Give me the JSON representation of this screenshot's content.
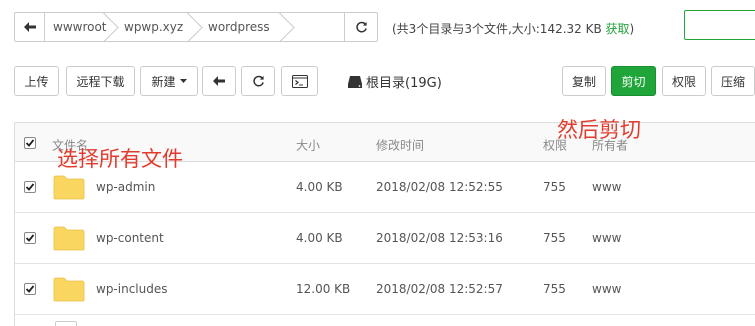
{
  "path": {
    "crumbs": [
      "wwwroot",
      "wpwp.xyz",
      "wordpress"
    ],
    "summary_text": "(共3个目录与3个文件,大小:142.32 KB ",
    "fetch_label": "获取",
    "summary_close": ")"
  },
  "toolbar": {
    "upload": "上传",
    "remote_download": "远程下载",
    "new": "新建",
    "disk_label": "根目录(19G)",
    "copy": "复制",
    "cut": "剪切",
    "permission": "权限",
    "compress": "压缩"
  },
  "table": {
    "headers": {
      "name": "文件名",
      "size": "大小",
      "modified": "修改时间",
      "perm": "权限",
      "owner": "所有者"
    },
    "rows": [
      {
        "name": "wp-admin",
        "size": "4.00 KB",
        "modified": "2018/02/08 12:52:55",
        "perm": "755",
        "owner": "www",
        "checked": true
      },
      {
        "name": "wp-content",
        "size": "4.00 KB",
        "modified": "2018/02/08 12:53:16",
        "perm": "755",
        "owner": "www",
        "checked": true
      },
      {
        "name": "wp-includes",
        "size": "12.00 KB",
        "modified": "2018/02/08 12:52:57",
        "perm": "755",
        "owner": "www",
        "checked": true
      }
    ]
  },
  "annotations": {
    "select_all": "选择所有文件",
    "then_cut": "然后剪切"
  },
  "colors": {
    "accent": "#20a53a",
    "annotation": "#e23b2e",
    "folder": "#f9d65f"
  },
  "icons": [
    "arrow-left-icon",
    "refresh-icon",
    "caret-down-icon",
    "terminal-icon",
    "disk-icon",
    "checkbox-checked-icon",
    "folder-icon"
  ]
}
